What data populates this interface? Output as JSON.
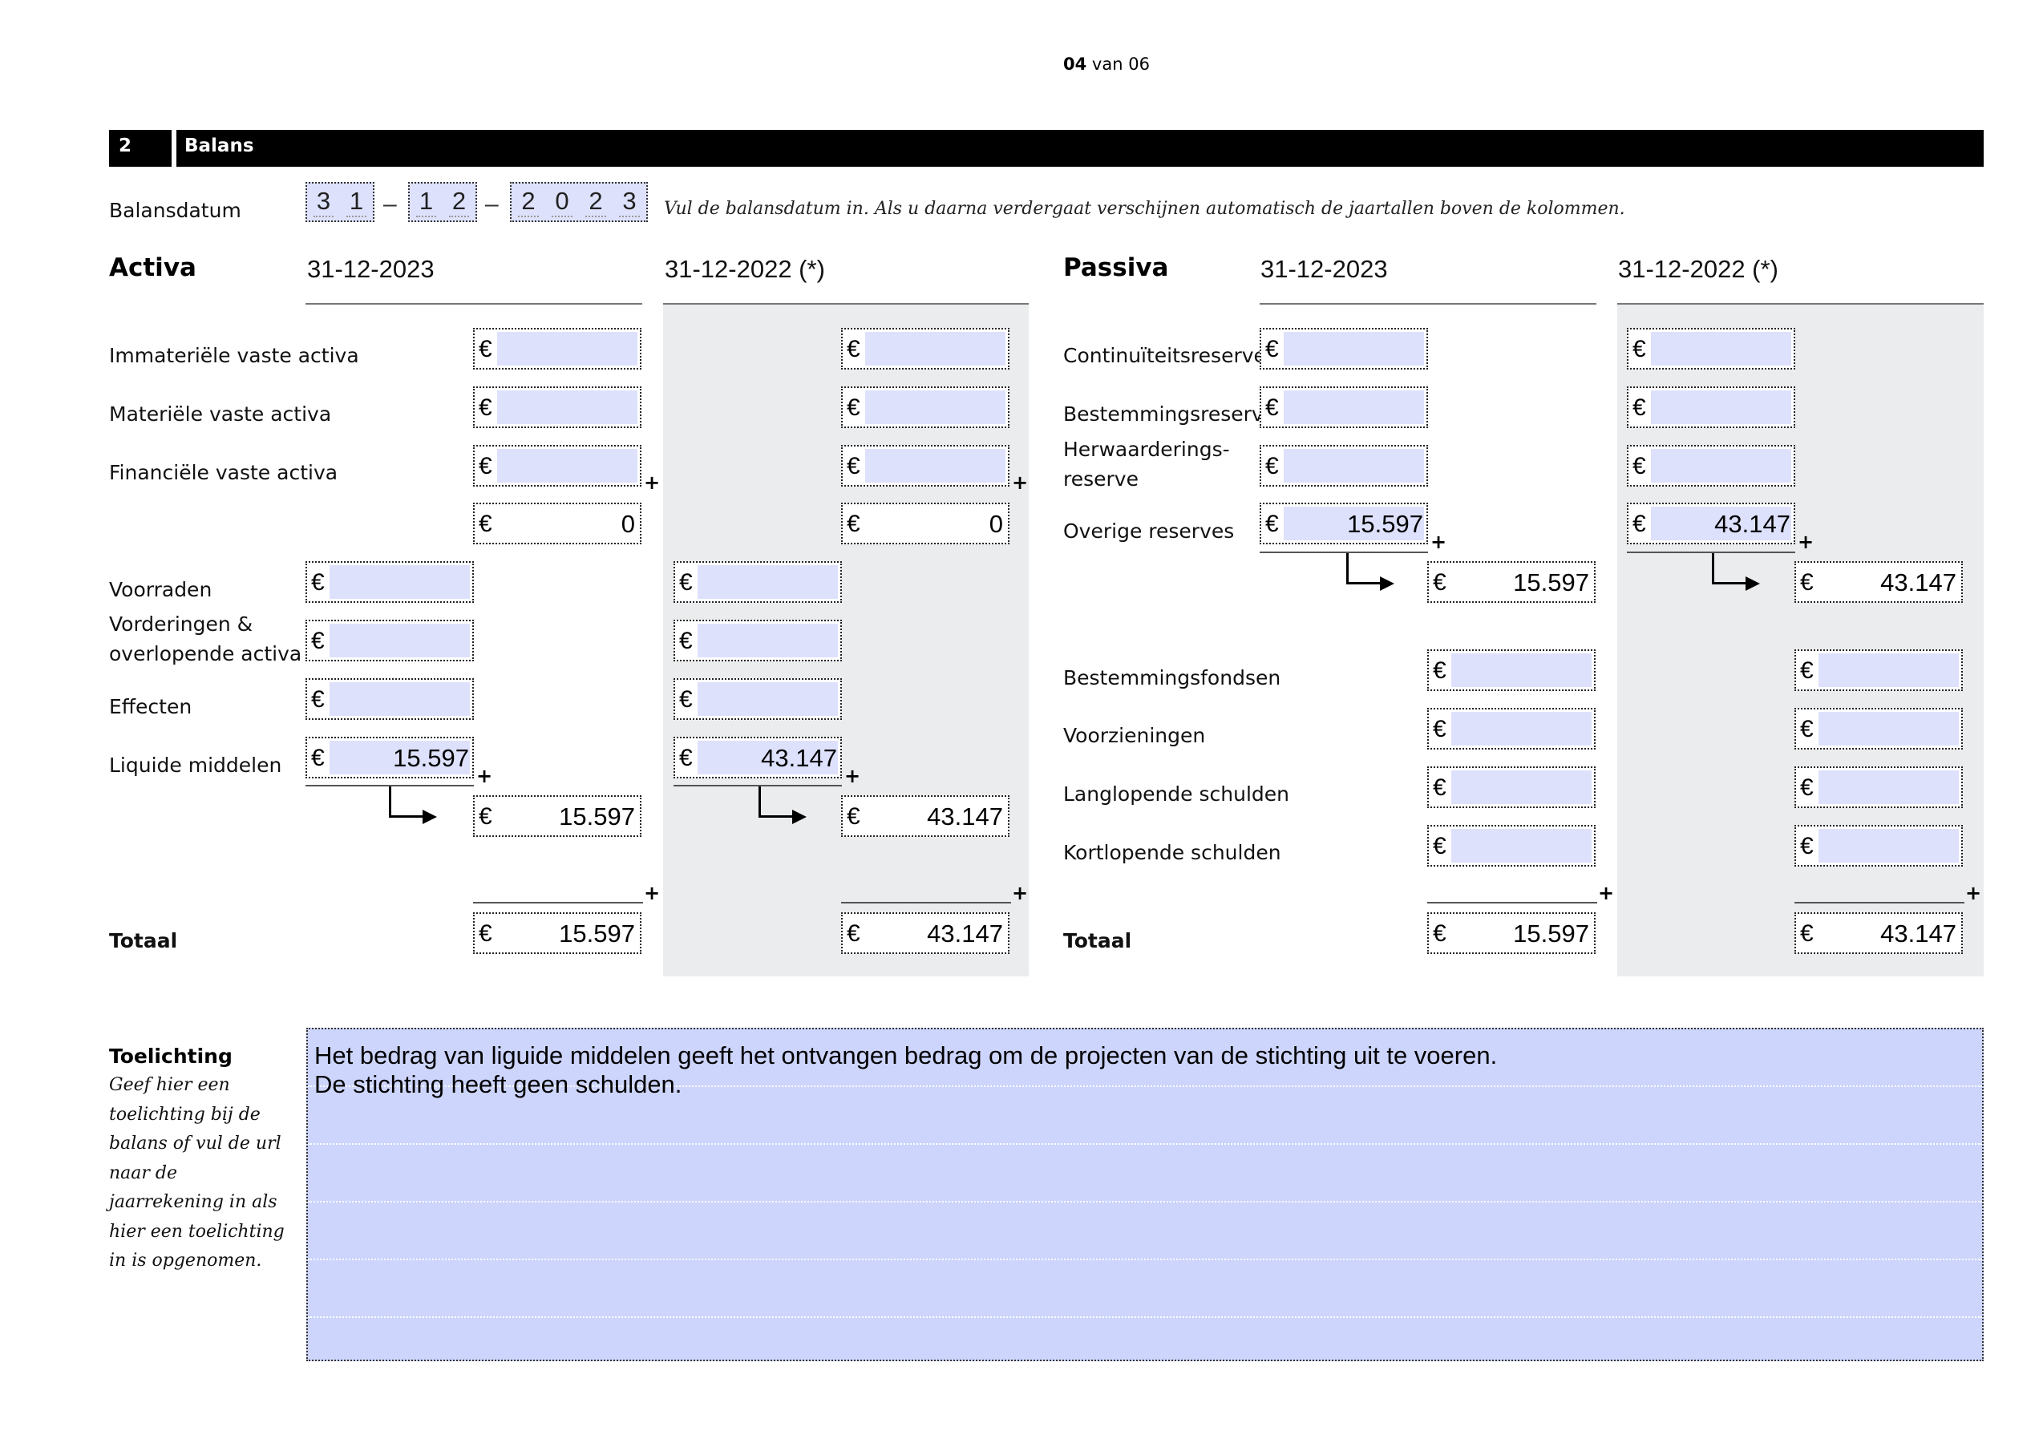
{
  "page": {
    "current": "04",
    "of_text": "van 06"
  },
  "section": {
    "number": "2",
    "title": "Balans"
  },
  "balansdatum": {
    "label": "Balansdatum",
    "day": [
      "3",
      "1"
    ],
    "month": [
      "1",
      "2"
    ],
    "year": [
      "2",
      "0",
      "2",
      "3"
    ],
    "separator": "–",
    "hint": "Vul de balansdatum in. Als u daarna verdergaat verschijnen automatisch de jaartallen boven de kolommen."
  },
  "activa": {
    "title": "Activa",
    "col_current": "31-12-2023",
    "col_previous": "31-12-2022 (*)",
    "rows": {
      "immaterieel": "Immateriële vaste activa",
      "materieel": "Materiële vaste activa",
      "financieel": "Financiële vaste activa",
      "voorraden": "Voorraden",
      "vorderingen_1": "Vorderingen &",
      "vorderingen_2": "overlopende activa",
      "effecten": "Effecten",
      "liquide": "Liquide middelen",
      "totaal": "Totaal"
    },
    "values_current": {
      "vaste_sum": "0",
      "liquide": "15.597",
      "vlottend_sum": "15.597",
      "totaal": "15.597"
    },
    "values_previous": {
      "vaste_sum": "0",
      "liquide": "43.147",
      "vlottend_sum": "43.147",
      "totaal": "43.147"
    }
  },
  "passiva": {
    "title": "Passiva",
    "col_current": "31-12-2023",
    "col_previous": "31-12-2022 (*)",
    "rows": {
      "continuiteit": "Continuïteitsreserve",
      "bestemmingsreserve": "Bestemmingsreserve",
      "herwaardering_1": "Herwaarderings-",
      "herwaardering_2": "reserve",
      "overige": "Overige reserves",
      "bestemmingsfondsen": "Bestemmingsfondsen",
      "voorzieningen": "Voorzieningen",
      "langlopend": "Langlopende schulden",
      "kortlopend": "Kortlopende schulden",
      "totaal": "Totaal"
    },
    "values_current": {
      "overige": "15.597",
      "reserves_sum": "15.597",
      "totaal": "15.597"
    },
    "values_previous": {
      "overige": "43.147",
      "reserves_sum": "43.147",
      "totaal": "43.147"
    }
  },
  "symbols": {
    "euro": "€",
    "plus": "+"
  },
  "toelichting": {
    "title": "Toelichting",
    "help": "Geef hier een toelichting bij de balans of vul de url naar de jaarrekening in als hier een toelichting in is opgenomen.",
    "text": "Het bedrag van liguide middelen geeft het ontvangen bedrag om de projecten van de stichting uit te voeren.\nDe stichting heeft geen schulden."
  },
  "colors": {
    "input_fill": "#dde1fb",
    "textarea_fill": "#cdd5fc",
    "shade": "#ebeced",
    "section_bar": "#000000"
  }
}
